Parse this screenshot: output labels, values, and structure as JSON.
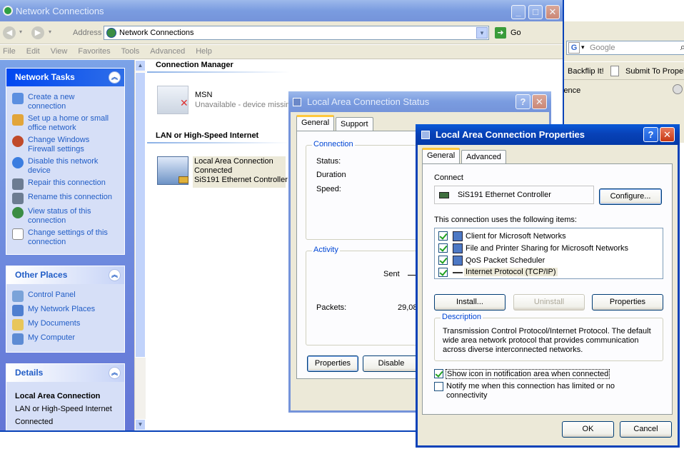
{
  "explorer": {
    "title": "Network Connections",
    "address_label": "Address",
    "address_value": "Network Connections",
    "go_label": "Go",
    "menu": [
      "File",
      "Edit",
      "View",
      "Favorites",
      "Tools",
      "Advanced",
      "Help"
    ],
    "network_tasks_title": "Network Tasks",
    "network_tasks": [
      {
        "label": "Create a new connection",
        "icon": "new-connection-icon"
      },
      {
        "label": "Set up a home or small office network",
        "icon": "home-network-icon"
      },
      {
        "label": "Change Windows Firewall settings",
        "icon": "firewall-icon"
      },
      {
        "label": "Disable this network device",
        "icon": "disable-icon"
      },
      {
        "label": "Repair this connection",
        "icon": "repair-icon"
      },
      {
        "label": "Rename this connection",
        "icon": "rename-icon"
      },
      {
        "label": "View status of this connection",
        "icon": "status-icon"
      },
      {
        "label": "Change settings of this connection",
        "icon": "settings-icon"
      }
    ],
    "other_places_title": "Other Places",
    "other_places": [
      "Control Panel",
      "My Network Places",
      "My Documents",
      "My Computer"
    ],
    "details_title": "Details",
    "details_name": "Local Area Connection",
    "details_type": "LAN or High-Speed Internet",
    "details_status": "Connected",
    "section_connection_manager": "Connection Manager",
    "msn_name": "MSN",
    "msn_status": "Unavailable - device missing",
    "section_lan": "LAN or High-Speed Internet",
    "lan_name": "Local Area Connection",
    "lan_status": "Connected",
    "lan_device": "SiS191 Ethernet Controller"
  },
  "browser_bg": {
    "search_placeholder": "Google",
    "link1": "Backflip It!",
    "link2": "Submit To Propell",
    "text_partial": "lence"
  },
  "status_dialog": {
    "title": "Local Area Connection Status",
    "tabs": [
      "General",
      "Support"
    ],
    "connection_group": "Connection",
    "status_label": "Status:",
    "duration_label": "Duration",
    "speed_label": "Speed:",
    "activity_group": "Activity",
    "sent_label": "Sent",
    "packets_label": "Packets:",
    "packets_sent": "29,08",
    "properties_btn": "Properties",
    "disable_btn": "Disable"
  },
  "props_dialog": {
    "title": "Local Area Connection Properties",
    "tabs": [
      "General",
      "Advanced"
    ],
    "connect_label": "Connect",
    "adapter": "SiS191 Ethernet Controller",
    "configure_btn": "Configure...",
    "items_label": "This connection uses the following items:",
    "items": [
      {
        "label": "Client for Microsoft Networks",
        "checked": true
      },
      {
        "label": "File and Printer Sharing for Microsoft Networks",
        "checked": true
      },
      {
        "label": "QoS Packet Scheduler",
        "checked": true
      },
      {
        "label": "Internet Protocol (TCP/IP)",
        "checked": true
      }
    ],
    "install_btn": "Install...",
    "uninstall_btn": "Uninstall",
    "properties_btn": "Properties",
    "description_group": "Description",
    "description_text": "Transmission Control Protocol/Internet Protocol. The default wide area network protocol that provides communication across diverse interconnected networks.",
    "show_icon_label": "Show icon in notification area when connected",
    "show_icon_checked": true,
    "notify_label": "Notify me when this connection has limited or no connectivity",
    "notify_checked": false,
    "ok_btn": "OK",
    "cancel_btn": "Cancel"
  },
  "colors": {
    "xp_blue": "#0842b8",
    "dialog_face": "#ece9d8",
    "task_link": "#215dc6",
    "panel_bg": "#6f8fdc"
  }
}
